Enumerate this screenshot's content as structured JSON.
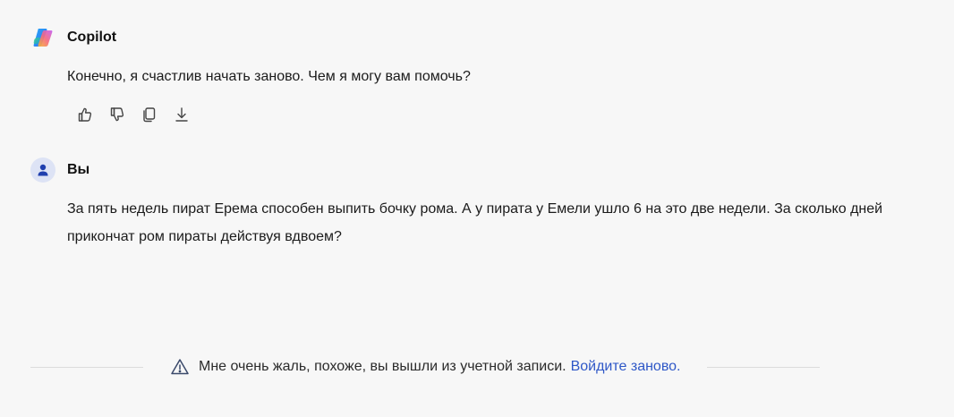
{
  "conversation": {
    "copilot_message": {
      "sender": "Copilot",
      "text": "Конечно, я счастлив начать заново. Чем я могу вам помочь?",
      "actions": [
        {
          "icon": "thumbs-up-icon"
        },
        {
          "icon": "thumbs-down-icon"
        },
        {
          "icon": "copy-icon"
        },
        {
          "icon": "download-icon"
        }
      ]
    },
    "user_message": {
      "sender": "Вы",
      "text": "За пять недель пират Ерема способен выпить бочку рома. А у пирата у Емели ушло 6 на это две недели. За сколько дней прикончат ром пираты действуя вдвоем?"
    }
  },
  "notice": {
    "icon": "warning-icon",
    "text": "Мне очень жаль, похоже, вы вышли из учетной записи.",
    "link": "Войдите заново."
  },
  "colors": {
    "background": "#f7f7f7",
    "link": "#2e57c7",
    "user_avatar_bg": "#dde3f5",
    "user_avatar_fg": "#1f3fae"
  }
}
